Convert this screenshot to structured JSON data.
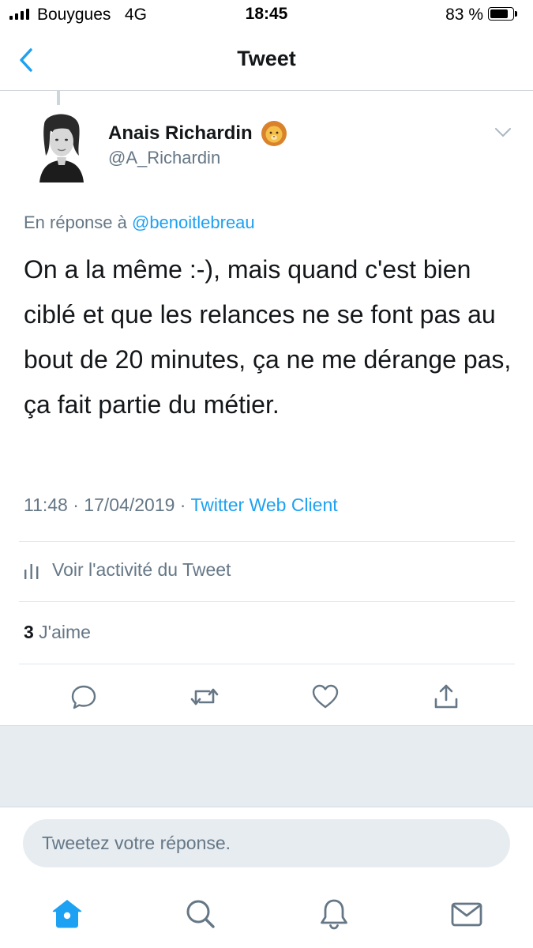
{
  "status_bar": {
    "carrier": "Bouygues   4G",
    "time": "18:45",
    "battery_percent": "83 %",
    "battery_level": 0.83
  },
  "nav": {
    "title": "Tweet",
    "back_icon": "chevron-left-icon"
  },
  "tweet": {
    "author_name": "Anais Richardin",
    "author_emoji_icon": "lion-face-icon",
    "author_handle": "@A_Richardin",
    "reply_prefix": "En réponse à ",
    "reply_mention": "@benoitlebreau",
    "text": "On a la même :-), mais quand c'est bien ciblé et que les relances ne se font pas au bout de 20 minutes, ça ne me dérange pas, ça fait partie du métier.",
    "timestamp": "11:48 · 17/04/2019 · ",
    "client": "Twitter Web Client"
  },
  "activity": {
    "label": "Voir l'activité du Tweet",
    "icon": "bar-chart-icon"
  },
  "likes": {
    "count": "3",
    "label": " J'aime"
  },
  "actions": [
    {
      "name": "reply",
      "icon": "reply-bubble-icon"
    },
    {
      "name": "retweet",
      "icon": "retweet-icon"
    },
    {
      "name": "like",
      "icon": "heart-icon"
    },
    {
      "name": "share",
      "icon": "share-icon"
    }
  ],
  "reply_box": {
    "placeholder": "Tweetez votre réponse."
  },
  "tab_bar": [
    {
      "name": "home",
      "icon": "home-icon",
      "active": true
    },
    {
      "name": "search",
      "icon": "search-icon",
      "active": false
    },
    {
      "name": "notifications",
      "icon": "bell-icon",
      "active": false
    },
    {
      "name": "messages",
      "icon": "envelope-icon",
      "active": false
    }
  ],
  "colors": {
    "accent": "#1da1f2",
    "text_primary": "#14171a",
    "text_secondary": "#657786",
    "separator": "#e1e8ed",
    "background_gray": "#e6ecf0"
  }
}
